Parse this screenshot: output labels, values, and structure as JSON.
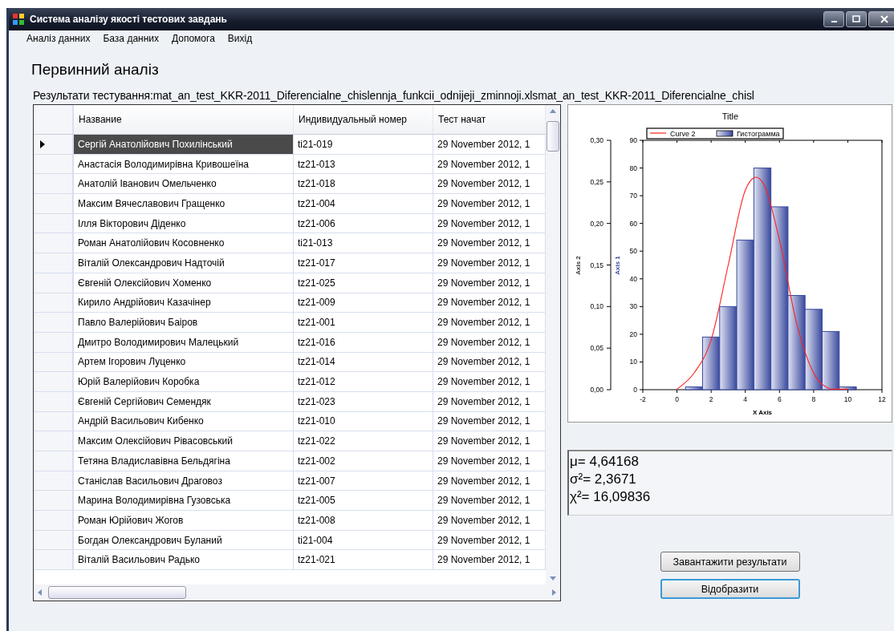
{
  "window": {
    "title": "Система аналізу якості тестових завдань"
  },
  "menu": [
    {
      "label": "Аналіз данних"
    },
    {
      "label": "База данних"
    },
    {
      "label": "Допомога"
    },
    {
      "label": "Вихід"
    }
  ],
  "heading": "Первинний аналіз",
  "results_label": "Результати тестування:mat_an_test_KKR-2011_Diferencialne_chislennja_funkcii_odnijeji_zminnoji.xlsmat_an_test_KKR-2011_Diferencialne_chisl",
  "table": {
    "columns": [
      "Название",
      "Индивидуальный номер",
      "Тест начат"
    ],
    "rows": [
      {
        "name": "Сергій Анатолійович Похилінський",
        "id": "ti21-019",
        "started": "29 November 2012, 1",
        "selected": true
      },
      {
        "name": "Анастасія Володимирівна Кривошеїна",
        "id": "tz21-013",
        "started": "29 November 2012, 1",
        "selected": false
      },
      {
        "name": "Анатолій Іванович Омельченко",
        "id": "tz21-018",
        "started": "29 November 2012, 1",
        "selected": false
      },
      {
        "name": "Максим Вячеславович Гращенко",
        "id": "tz21-004",
        "started": "29 November 2012, 1",
        "selected": false
      },
      {
        "name": "Ілля Вікторович Діденко",
        "id": "tz21-006",
        "started": "29 November 2012, 1",
        "selected": false
      },
      {
        "name": "Роман Анатолійович Косовненко",
        "id": "ti21-013",
        "started": "29 November 2012, 1",
        "selected": false
      },
      {
        "name": "Віталій Олександрович Надточій",
        "id": "tz21-017",
        "started": "29 November 2012, 1",
        "selected": false
      },
      {
        "name": "Євгеній Олексійович Хоменко",
        "id": "tz21-025",
        "started": "29 November 2012, 1",
        "selected": false
      },
      {
        "name": "Кирило Андрійович Казачінер",
        "id": "tz21-009",
        "started": "29 November 2012, 1",
        "selected": false
      },
      {
        "name": "Павло Валерійович Баіров",
        "id": "tz21-001",
        "started": "29 November 2012, 1",
        "selected": false
      },
      {
        "name": "Дмитро Володимирович Малецький",
        "id": "tz21-016",
        "started": "29 November 2012, 1",
        "selected": false
      },
      {
        "name": "Артем Ігорович Луценко",
        "id": "tz21-014",
        "started": "29 November 2012, 1",
        "selected": false
      },
      {
        "name": "Юрій Валерійович Коробка",
        "id": "tz21-012",
        "started": "29 November 2012, 1",
        "selected": false
      },
      {
        "name": "Євгеній Сергійович Семендяк",
        "id": "tz21-023",
        "started": "29 November 2012, 1",
        "selected": false
      },
      {
        "name": "Андрій Васильович Кибенко",
        "id": "tz21-010",
        "started": "29 November 2012, 1",
        "selected": false
      },
      {
        "name": "Максим Олексійович Рівасовський",
        "id": "tz21-022",
        "started": "29 November 2012, 1",
        "selected": false
      },
      {
        "name": "Тетяна Владиславівна Бельдягіна",
        "id": "tz21-002",
        "started": "29 November 2012, 1",
        "selected": false
      },
      {
        "name": "Станіслав Васильович Драговоз",
        "id": "tz21-007",
        "started": "29 November 2012, 1",
        "selected": false
      },
      {
        "name": "Марина Володимирівна Гузовська",
        "id": "tz21-005",
        "started": "29 November 2012, 1",
        "selected": false
      },
      {
        "name": "Роман Юрійович Жогов",
        "id": "tz21-008",
        "started": "29 November 2012, 1",
        "selected": false
      },
      {
        "name": "Богдан Олександрович Буланий",
        "id": "ti21-004",
        "started": "29 November 2012, 1",
        "selected": false
      },
      {
        "name": "Віталій Васильович Радько",
        "id": "tz21-021",
        "started": "29 November 2012, 1",
        "selected": false
      }
    ]
  },
  "chart": {
    "chart_data": {
      "type": "bar",
      "title": "Title",
      "xlabel": "X Axis",
      "ylabel": "Axis 1",
      "y2label": "Axis 2",
      "legend": true,
      "x": [
        0,
        1,
        2,
        3,
        4,
        5,
        6,
        7,
        8,
        9,
        10
      ],
      "series": [
        {
          "name": "Curve 2",
          "color": "#ff2020",
          "type": "line",
          "axis": "y2",
          "values": [
            0,
            0.02,
            0.06,
            0.15,
            0.24,
            0.25,
            0.18,
            0.08,
            0.02,
            0,
            0
          ]
        },
        {
          "name": "Гистограмма",
          "color": "#3a4a9e",
          "values": [
            null,
            1,
            19,
            30,
            54,
            80,
            66,
            34,
            29,
            21,
            1
          ]
        }
      ],
      "xlim": [
        -2,
        12
      ],
      "ylim": [
        0,
        90
      ],
      "y2lim": [
        0,
        0.3
      ],
      "xticks": [
        -2,
        0,
        2,
        4,
        6,
        8,
        10,
        12
      ],
      "yticks": [
        0,
        10,
        20,
        30,
        40,
        50,
        60,
        70,
        80,
        90
      ],
      "y2ticks": [
        {
          "value": 0,
          "label": "0,00"
        },
        {
          "value": 0.05,
          "label": "0,05"
        },
        {
          "value": 0.1,
          "label": "0,10"
        },
        {
          "value": 0.15,
          "label": "0,15"
        },
        {
          "value": 0.2,
          "label": "0,20"
        },
        {
          "value": 0.25,
          "label": "0,25"
        },
        {
          "value": 0.3,
          "label": "0,30"
        }
      ]
    }
  },
  "stats": [
    "μ= 4,64168",
    "σ²= 2,3671",
    "χ²= 16,09836"
  ],
  "buttons": [
    {
      "label": "Завантажити результати",
      "focused": false
    },
    {
      "label": "Відобразити",
      "focused": true
    }
  ]
}
